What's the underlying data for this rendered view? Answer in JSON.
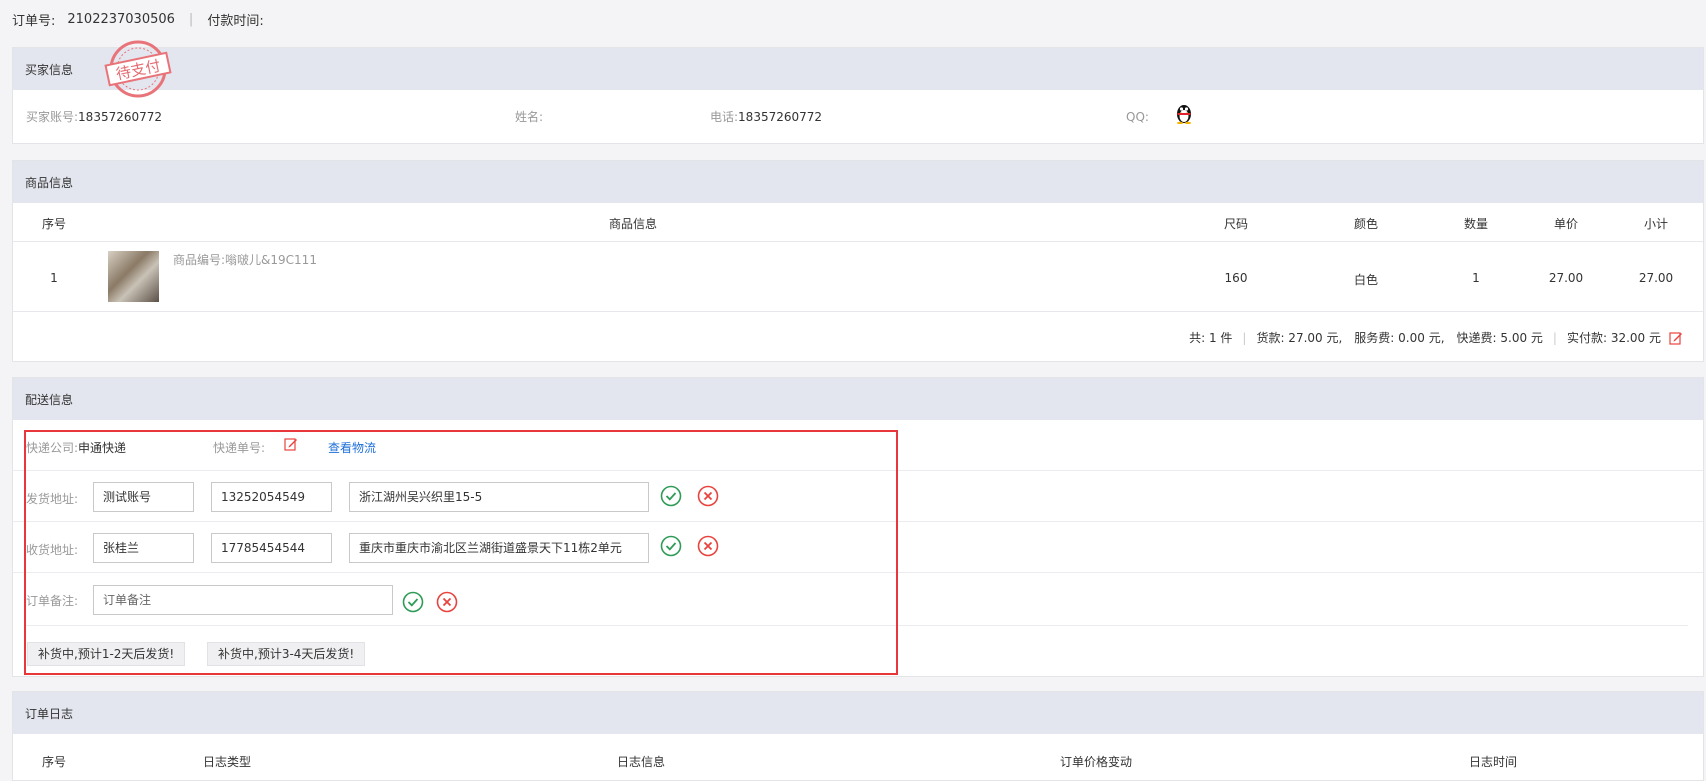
{
  "order": {
    "number_label": "订单号:",
    "number": "2102237030506",
    "separator": "|",
    "pay_time_label": "付款时间:",
    "pay_time": ""
  },
  "buyer": {
    "title": "买家信息",
    "stamp": "待支付",
    "account_label": "买家账号:",
    "account": "18357260772",
    "name_label": "姓名:",
    "name": "",
    "phone_label": "电话:",
    "phone": "18357260772",
    "qq_label": "QQ:",
    "qq_icon": "qq-penguin-icon"
  },
  "product": {
    "title": "商品信息",
    "columns": [
      "序号",
      "商品信息",
      "尺码",
      "颜色",
      "数量",
      "单价",
      "小计"
    ],
    "rows": [
      {
        "index": "1",
        "info": "商品编号:嗡啵儿&19C111",
        "size": "160",
        "color": "白色",
        "qty": "1",
        "price": "27.00",
        "subtotal": "27.00"
      }
    ],
    "summary": {
      "count_text": "共: 1 件",
      "bar": "|",
      "goods_text": "货款: 27.00  元,",
      "service_text": "服务费: 0.00  元,",
      "shipping_text": "快递费: 5.00  元",
      "paid_text": "实付款: 32.00 元"
    }
  },
  "delivery": {
    "title": "配送信息",
    "courier_label": "快递公司:",
    "courier": "申通快递",
    "tracking_label": "快递单号:",
    "view_logistics": "查看物流",
    "sender_label": "发货地址:",
    "sender_name": "测试账号",
    "sender_phone": "13252054549",
    "sender_address": "浙江湖州吴兴织里15-5",
    "receiver_label": "收货地址:",
    "receiver_name": "张桂兰",
    "receiver_phone": "17785454544",
    "receiver_address": "重庆市重庆市渝北区兰湖街道盛景天下11栋2单元",
    "remark_label": "订单备注:",
    "remark_placeholder": "订单备注",
    "tags": [
      "补货中,预计1-2天后发货!",
      "补货中,预计3-4天后发货!"
    ]
  },
  "log": {
    "title": "订单日志",
    "columns": [
      "序号",
      "日志类型",
      "日志信息",
      "订单价格变动",
      "日志时间"
    ]
  },
  "colors": {
    "accent_link": "#1e6fd9",
    "confirm_green": "#2e9b57",
    "cancel_red": "#e8433e",
    "highlight_red": "#e8373b",
    "panel_header": "#e3e6ee"
  }
}
